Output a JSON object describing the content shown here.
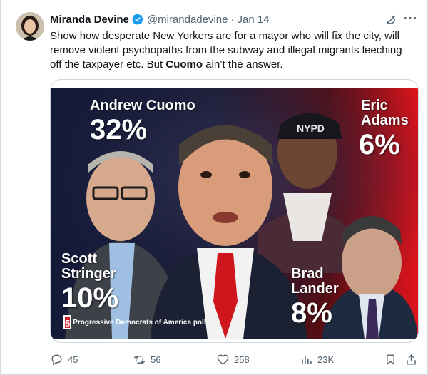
{
  "author": {
    "name": "Miranda Devine",
    "handle": "@mirandadevine",
    "date": "Jan 14",
    "verified": true
  },
  "tweet": {
    "text_before": "Show how desperate New Yorkers are for a mayor who will fix the city, will remove violent psychopaths from the subway and illegal migrants leeching off the taxpayer etc. But ",
    "text_bold": "Cuomo",
    "text_after": " ain’t the answer."
  },
  "image": {
    "candidates": [
      {
        "name_line1": "Andrew Cuomo",
        "name_line2": "",
        "percent": "32%"
      },
      {
        "name_line1": "Eric",
        "name_line2": "Adams",
        "percent": "6%"
      },
      {
        "name_line1": "Scott",
        "name_line2": "Stringer",
        "percent": "10%"
      },
      {
        "name_line1": "Brad",
        "name_line2": "Lander",
        "percent": "8%"
      }
    ],
    "cap_text": "NYPD",
    "logo_text": "5",
    "poll_label": "Progressive Democrats of America poll"
  },
  "actions": {
    "replies": "45",
    "reposts": "56",
    "likes": "258",
    "views": "23K"
  },
  "colors": {
    "verified_blue": "#1d9bf0",
    "muted": "#536471",
    "accent_red": "#d21d24"
  }
}
